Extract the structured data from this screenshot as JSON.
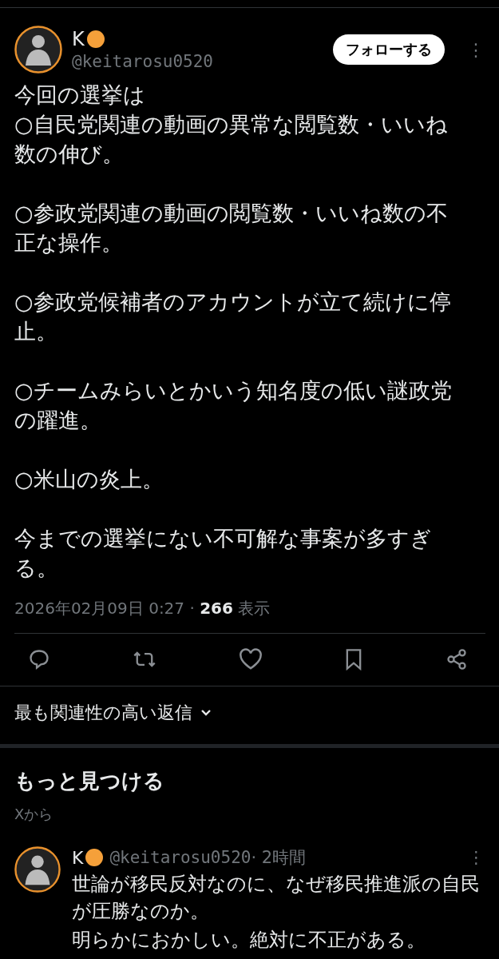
{
  "post": {
    "author": {
      "name": "K",
      "handle": "@keitarosu0520"
    },
    "follow_button": "フォローする",
    "more": "⋮",
    "intro": "今回の選挙は",
    "paragraphs": [
      "○自民党関連の動画の異常な閲覧数・いいね数の伸び。",
      "○参政党関連の動画の閲覧数・いいね数の不正な操作。",
      "○参政党候補者のアカウントが立て続けに停止。",
      "○チームみらいとかいう知名度の低い謎政党の躍進。",
      "○米山の炎上。",
      "今までの選挙にない不可解な事案が多すぎる。"
    ],
    "timestamp": "2026年02月09日 0:27 · ",
    "views": "266",
    "views_label": " 表示",
    "actions": [
      {
        "kind": "reply"
      },
      {
        "kind": "repost"
      },
      {
        "kind": "like"
      },
      {
        "kind": "bookmark"
      },
      {
        "kind": "share"
      }
    ]
  },
  "replies_sort": "最も関連性の高い返信",
  "discover": {
    "title": "もっと見つける",
    "subtitle": "Xから",
    "posts": [
      {
        "name": "K",
        "handle": "@keitarosu0520",
        "time": " · 2時間",
        "more": "⋮",
        "lines": [
          "世論が移民反対なのに、なぜ移民推進派の自民が圧勝なのか。",
          "明らかにおかしい。絶対に不正がある。"
        ]
      }
    ]
  }
}
